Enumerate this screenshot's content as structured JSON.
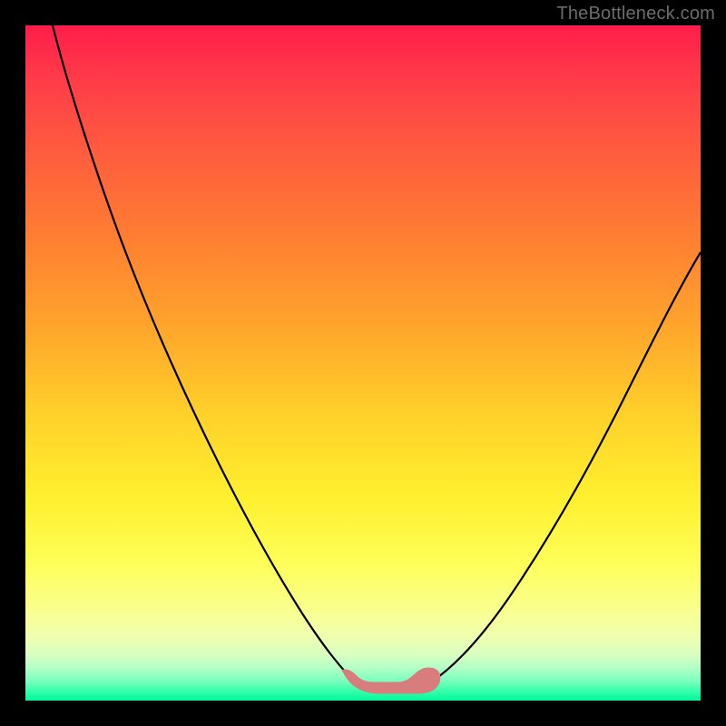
{
  "watermark": {
    "text": "TheBottleneck.com"
  },
  "colors": {
    "background": "#000000",
    "curve": "#000000",
    "blob": "#d97c7e"
  },
  "chart_data": {
    "type": "line",
    "title": "",
    "xlabel": "",
    "ylabel": "",
    "xlim": [
      0,
      100
    ],
    "ylim": [
      0,
      100
    ],
    "series": [
      {
        "name": "left-curve",
        "x": [
          4,
          6,
          9,
          12,
          15,
          18,
          22,
          26,
          30,
          34,
          38,
          42,
          46,
          48.5
        ],
        "y": [
          100,
          92,
          82,
          72,
          63,
          55,
          46,
          38,
          30,
          23,
          16,
          10,
          5,
          2
        ]
      },
      {
        "name": "right-curve",
        "x": [
          60,
          64,
          68,
          72,
          76,
          80,
          84,
          88,
          92,
          96,
          100
        ],
        "y": [
          2,
          5,
          9,
          14,
          20,
          27,
          34,
          42,
          50,
          58,
          66
        ]
      },
      {
        "name": "bottom-blob",
        "x": [
          47,
          49,
          51,
          53,
          55,
          57,
          59,
          61
        ],
        "y": [
          3,
          1.5,
          1,
          1,
          1,
          1,
          1.5,
          3
        ]
      }
    ]
  }
}
